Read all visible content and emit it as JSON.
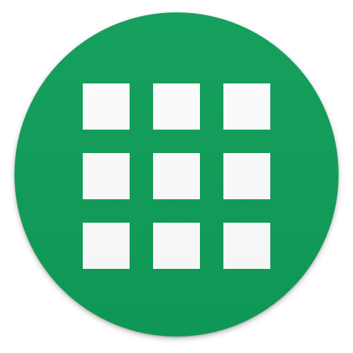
{
  "app_icon": {
    "icon_name": "app-grid-icon",
    "shape": "circle",
    "background_color": "#0f9d58",
    "tile_color": "#fdfdfd",
    "grid": {
      "rows": 3,
      "columns": 3
    }
  }
}
